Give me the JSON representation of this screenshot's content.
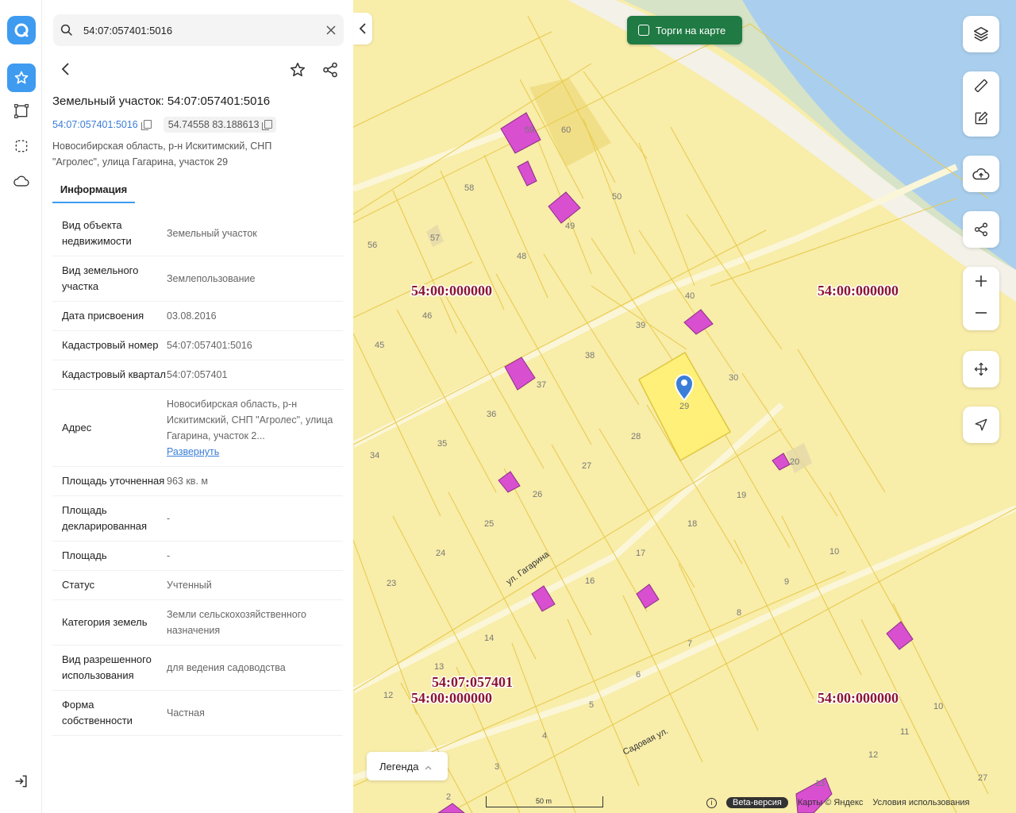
{
  "rail": {
    "items": [
      "logo",
      "favorites",
      "draw",
      "select-area",
      "cloud"
    ]
  },
  "search": {
    "value": "54:07:057401:5016"
  },
  "object": {
    "title": "Земельный участок: 54:07:057401:5016",
    "cadastral_link": "54:07:057401:5016",
    "coordinates": "54.74558 83.188613",
    "address_line1": "Новосибирская область, р-н Искитимский, СНП",
    "address_line2": "\"Агролес\", улица Гагарина, участок 29"
  },
  "tabs": {
    "info": "Информация"
  },
  "rows": [
    {
      "k": "Вид объекта недвижимости",
      "v": "Земельный участок"
    },
    {
      "k": "Вид земельного участка",
      "v": "Землепользование"
    },
    {
      "k": "Дата присвоения",
      "v": "03.08.2016"
    },
    {
      "k": "Кадастровый номер",
      "v": "54:07:057401:5016"
    },
    {
      "k": "Кадастровый квартал",
      "v": "54:07:057401"
    },
    {
      "k": "Адрес",
      "v": "Новосибирская область, р-н Искитимский, СНП \"Агролес\", улица Гагарина, участок 2..."
    },
    {
      "k": "Площадь уточненная",
      "v": "963 кв. м"
    },
    {
      "k": "Площадь декларированная",
      "v": "-"
    },
    {
      "k": "Площадь",
      "v": "-"
    },
    {
      "k": "Статус",
      "v": "Учтенный"
    },
    {
      "k": "Категория земель",
      "v": "Земли сельскохозяйственного назначения"
    },
    {
      "k": "Вид разрешенного использования",
      "v": "для ведения садоводства"
    },
    {
      "k": "Форма собственности",
      "v": "Частная"
    }
  ],
  "address_expand": "Развернуть",
  "map": {
    "torgi": "Торги на карте",
    "legend": "Легенда",
    "scale": "50 m",
    "beta": "Beta-версия",
    "copyright": "Карты © Яндекс",
    "terms": "Условия использования",
    "street1": "ул. Гагарина",
    "street2": "Садовая ул.",
    "quarter_zero": "54:00:000000",
    "quarter_main": "54:07:057401",
    "plots": [
      "59",
      "60",
      "58",
      "50",
      "49",
      "57",
      "56",
      "48",
      "46",
      "40",
      "45",
      "39",
      "38",
      "37",
      "30",
      "36",
      "29",
      "28",
      "35",
      "34",
      "27",
      "20",
      "26",
      "19",
      "25",
      "18",
      "24",
      "17",
      "10",
      "23",
      "16",
      "9",
      "8",
      "14",
      "7",
      "13",
      "6",
      "12",
      "5",
      "11",
      "4",
      "12",
      "10",
      "3",
      "2",
      "27",
      "13"
    ]
  },
  "colors": {
    "accent": "#3e9bf0",
    "torgi_bg": "#1f7a43",
    "map_land": "#f8eda9",
    "selected_plot": "#fff07a",
    "building": "#d84fd0",
    "quarter_label": "#8b1530"
  }
}
